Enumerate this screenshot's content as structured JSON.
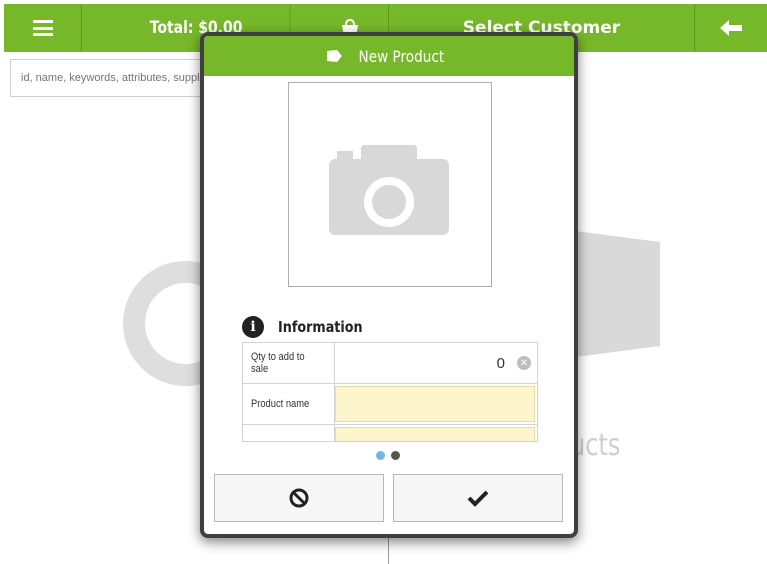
{
  "topbar": {
    "total_label": "Total: $0.00",
    "customer_label": "Select Customer"
  },
  "search": {
    "placeholder": "id, name, keywords, attributes, suppl"
  },
  "background": {
    "products_label": "ucts"
  },
  "modal": {
    "title": "New Product",
    "section_title": "Information",
    "fields": [
      {
        "label": "Qty to add to sale",
        "value": "0"
      },
      {
        "label": "Product name",
        "value": ""
      },
      {
        "label": "",
        "value": ""
      }
    ],
    "pagination": {
      "count": 2,
      "active": 1
    }
  },
  "colors": {
    "brand_green": "#76b82a",
    "field_yellow": "#fdf6cd",
    "dot_active": "#6fb8e6",
    "dot_inactive": "#555555"
  },
  "icons": {
    "menu": "hamburger-icon",
    "bag": "bag-icon",
    "back": "arrow-left-icon",
    "camera": "camera-icon",
    "info": "info-icon",
    "cancel": "ban-icon",
    "confirm": "checkmark-icon"
  }
}
